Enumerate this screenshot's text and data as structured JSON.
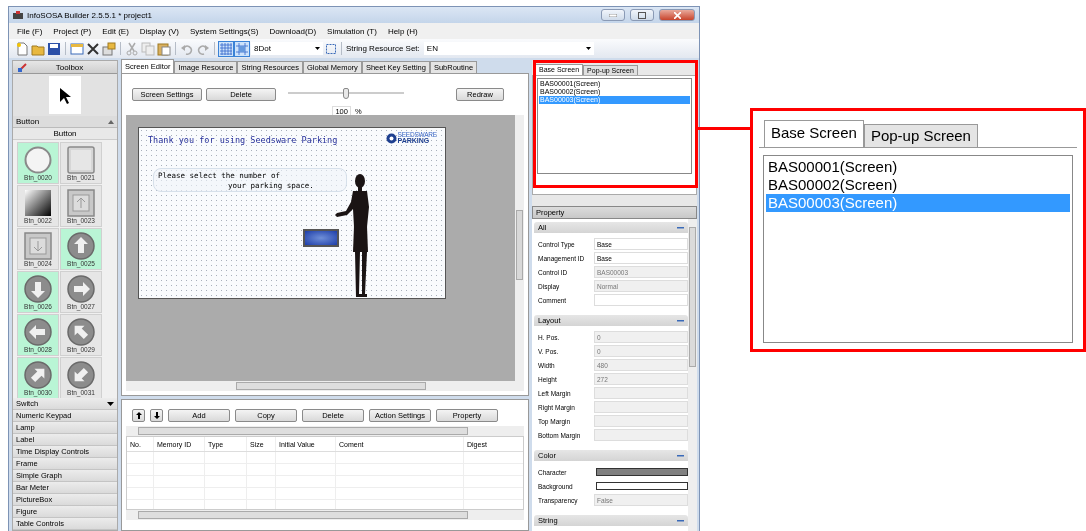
{
  "window": {
    "title": "InfoSOSA Builder 2.5.5.1 * project1"
  },
  "menu": [
    "File (F)",
    "Project (P)",
    "Edit (E)",
    "Display (V)",
    "System Settings(S)",
    "Download(D)",
    "Simulation (T)",
    "Help (H)"
  ],
  "toolbar": {
    "grid_select": "8Dot",
    "string_resource_label": "String Resource Set:",
    "string_resource_select": "EN"
  },
  "toolbox": {
    "title": "Toolbox",
    "group": {
      "label": "Button",
      "expanded": true
    },
    "subgroup": "Button",
    "items": [
      {
        "label": "Btn_0020",
        "kind": "circle",
        "highlighted": true
      },
      {
        "label": "Btn_0021",
        "kind": "square",
        "highlighted": false
      },
      {
        "label": "Btn_0022",
        "kind": "gradient",
        "highlighted": false
      },
      {
        "label": "Btn_0023",
        "kind": "framed-up",
        "highlighted": false
      },
      {
        "label": "Btn_0024",
        "kind": "framed-down",
        "highlighted": false
      },
      {
        "label": "Btn_0025",
        "kind": "arrow-up",
        "highlighted": true
      },
      {
        "label": "Btn_0026",
        "kind": "arrow-down",
        "highlighted": true
      },
      {
        "label": "Btn_0027",
        "kind": "arrow-right",
        "highlighted": false
      },
      {
        "label": "Btn_0028",
        "kind": "arrow-left",
        "highlighted": true
      },
      {
        "label": "Btn_0029",
        "kind": "arrow-up-left",
        "highlighted": false
      },
      {
        "label": "Btn_0030",
        "kind": "arrow-up-right",
        "highlighted": true
      },
      {
        "label": "Btn_0031",
        "kind": "arrow-down-left",
        "highlighted": false
      }
    ],
    "categories": [
      {
        "label": "Switch",
        "dropdown": true
      },
      {
        "label": "Numeric Keypad",
        "dropdown": false
      },
      {
        "label": "Lamp",
        "dropdown": false
      },
      {
        "label": "Label",
        "dropdown": false
      },
      {
        "label": "Time Display Controls",
        "dropdown": false
      },
      {
        "label": "Frame",
        "dropdown": false
      },
      {
        "label": "Simple Graph",
        "dropdown": false
      },
      {
        "label": "Bar Meter",
        "dropdown": false
      },
      {
        "label": "PictureBox",
        "dropdown": false
      },
      {
        "label": "Figure",
        "dropdown": false
      },
      {
        "label": "Table Controls",
        "dropdown": false
      }
    ]
  },
  "editor": {
    "tabs": [
      {
        "label": "Screen Editor",
        "selected": true
      },
      {
        "label": "Image Resource",
        "selected": false
      },
      {
        "label": "String Resources",
        "selected": false
      },
      {
        "label": "Global Memory",
        "selected": false
      },
      {
        "label": "Sheet Key Setting",
        "selected": false
      },
      {
        "label": "SubRoutine",
        "selected": false
      }
    ],
    "buttons": [
      "Screen Settings",
      "Delete"
    ],
    "redraw": "Redraw",
    "zoom": {
      "level": 0.5,
      "value": "100",
      "unit": "%"
    },
    "screen": {
      "title": "Thank you for using Seedsware Parking",
      "logo_top": "SEEDSWARE",
      "logo_bottom": "PARKING",
      "message": [
        "Please select the number of",
        "your parking space."
      ]
    }
  },
  "memory": {
    "buttons": [
      "Add",
      "Copy",
      "Delete",
      "Action Settings",
      "Property"
    ],
    "columns": [
      "No.",
      "Memory ID",
      "Type",
      "Size",
      "Initial Value",
      "Coment",
      "Digest"
    ]
  },
  "screens": {
    "tabs": [
      {
        "label": "Base Screen",
        "selected": true
      },
      {
        "label": "Pop-up Screen",
        "selected": false
      }
    ],
    "items": [
      {
        "label": "BAS00001(Screen)",
        "selected": false
      },
      {
        "label": "BAS00002(Screen)",
        "selected": false
      },
      {
        "label": "BAS00003(Screen)",
        "selected": true
      }
    ]
  },
  "property": {
    "title": "Property",
    "groups": [
      {
        "title": "All",
        "rows": [
          {
            "label": "Control Type",
            "value": "Base",
            "disabled": false
          },
          {
            "label": "Management ID",
            "value": "Base",
            "disabled": false
          },
          {
            "label": "Control ID",
            "value": "BAS00003",
            "disabled": true
          },
          {
            "label": "Display",
            "value": "Normal",
            "disabled": true
          },
          {
            "label": "Comment",
            "disabled": false
          }
        ]
      },
      {
        "title": "Layout",
        "rows": [
          {
            "label": "H. Pos.",
            "value": "0",
            "disabled": true
          },
          {
            "label": "V. Pos.",
            "value": "0",
            "disabled": true
          },
          {
            "label": "Width",
            "value": "480",
            "disabled": true
          },
          {
            "label": "Height",
            "value": "272",
            "disabled": true
          },
          {
            "label": "Left Margin",
            "disabled": true
          },
          {
            "label": "Right Margin",
            "disabled": true
          },
          {
            "label": "Top Margin",
            "disabled": true
          },
          {
            "label": "Bottom Margin",
            "disabled": true
          }
        ]
      },
      {
        "title": "Color",
        "rows": [
          {
            "label": "Character",
            "kind": "swatch",
            "color": "#808080"
          },
          {
            "label": "Background",
            "kind": "swatch",
            "color": "#ffffff"
          },
          {
            "label": "Transparency",
            "kind": "text",
            "value": "False",
            "disabled": true
          }
        ]
      },
      {
        "title": "String"
      }
    ]
  },
  "callout": {
    "tabs": [
      {
        "label": "Base Screen",
        "selected": true
      },
      {
        "label": "Pop-up Screen",
        "selected": false
      }
    ],
    "items": [
      {
        "label": "BAS00001(Screen)",
        "selected": false
      },
      {
        "label": "BAS00002(Screen)",
        "selected": false
      },
      {
        "label": "BAS00003(Screen)",
        "selected": true
      }
    ]
  }
}
